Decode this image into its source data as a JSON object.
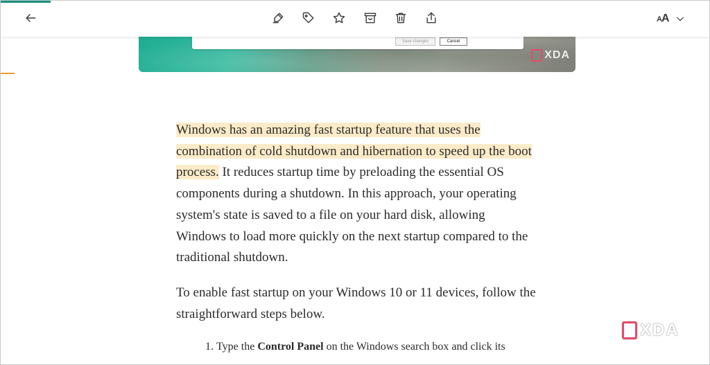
{
  "toolbar": {
    "icons": {
      "back": "arrow-left-icon",
      "highlight": "highlighter-icon",
      "tag": "tag-icon",
      "favorite": "star-icon",
      "archive": "archive-icon",
      "delete": "trash-icon",
      "share": "share-icon",
      "font": "font-size-icon",
      "font_menu": "chevron-down-icon"
    },
    "font_label_small": "A",
    "font_label_large": "A"
  },
  "image": {
    "dialog": {
      "save_label": "Save changes",
      "cancel_label": "Cancel"
    },
    "watermark": "XDA"
  },
  "article": {
    "p1_highlighted": "Windows has an amazing fast startup feature that uses the combination of cold shutdown and hibernation to speed up the boot process.",
    "p1_rest": " It reduces startup time by preloading the essential OS components during a shutdown. In this approach, your operating system's state is saved to a file on your hard disk, allowing Windows to load more quickly on the next startup compared to the traditional shutdown.",
    "p2": "To enable fast startup on your Windows 10 or 11 devices, follow the straightforward steps below.",
    "step1": {
      "before": "Type the ",
      "bold": "Control Panel",
      "after": " on the Windows search box and click its"
    }
  },
  "watermark": "XDA",
  "colors": {
    "highlight": "#fcebc8",
    "progress": "#1a8f7d",
    "accent_orange": "#e89a2e",
    "xda_pink": "#e24b6a"
  }
}
